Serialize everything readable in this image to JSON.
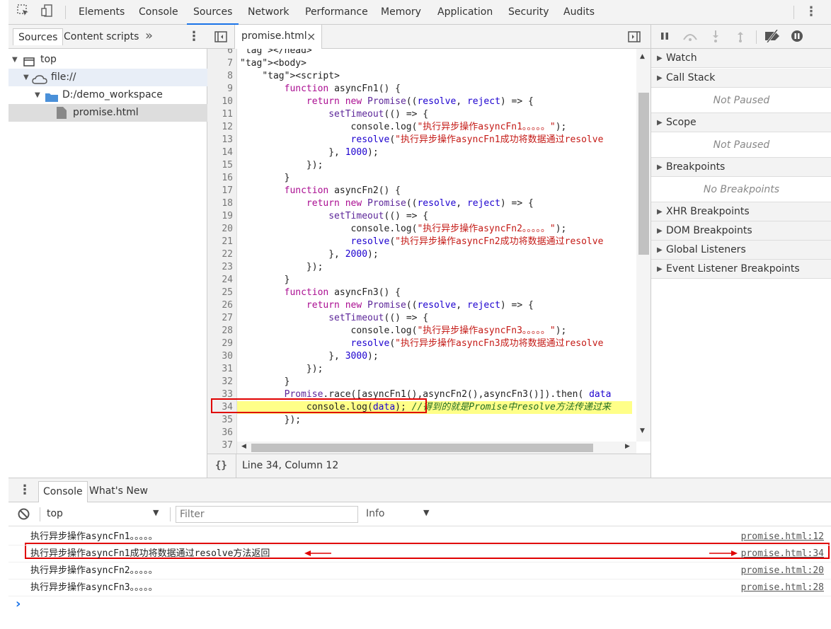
{
  "toolbar": {
    "tabs": [
      "Elements",
      "Console",
      "Sources",
      "Network",
      "Performance",
      "Memory",
      "Application",
      "Security",
      "Audits"
    ],
    "active_tab": "Sources",
    "more_icon": "kebab-icon",
    "accent_color": "#1a73e8"
  },
  "navigator": {
    "tabs": [
      "Sources",
      "Content scripts"
    ],
    "more": "»",
    "tree": [
      {
        "label": "top",
        "icon": "frame-icon"
      },
      {
        "label": "file://",
        "icon": "cloud-icon"
      },
      {
        "label": "D:/demo_workspace",
        "icon": "folder-icon"
      },
      {
        "label": "promise.html",
        "icon": "file-icon"
      }
    ]
  },
  "editor": {
    "tab_label": "promise.html",
    "close": "×",
    "footer_brackets": "{}",
    "cursor_position": "Line 34, Column 12",
    "highlighted_line": 34,
    "lines": [
      {
        "n": "6",
        "t": "</head>"
      },
      {
        "n": "7",
        "t": "<body>"
      },
      {
        "n": "8",
        "t": "    <script>"
      },
      {
        "n": "9",
        "t": "        function asyncFn1() {"
      },
      {
        "n": "10",
        "t": "            return new Promise((resolve, reject) => {"
      },
      {
        "n": "11",
        "t": "                setTimeout(() => {"
      },
      {
        "n": "12",
        "t": "                    console.log(\"执行异步操作asyncFn1。。。。。\");"
      },
      {
        "n": "13",
        "t": "                    resolve(\"执行异步操作asyncFn1成功将数据通过resolve"
      },
      {
        "n": "14",
        "t": "                }, 1000);"
      },
      {
        "n": "15",
        "t": "            });"
      },
      {
        "n": "16",
        "t": "        }"
      },
      {
        "n": "17",
        "t": "        function asyncFn2() {"
      },
      {
        "n": "18",
        "t": "            return new Promise((resolve, reject) => {"
      },
      {
        "n": "19",
        "t": "                setTimeout(() => {"
      },
      {
        "n": "20",
        "t": "                    console.log(\"执行异步操作asyncFn2。。。。。\");"
      },
      {
        "n": "21",
        "t": "                    resolve(\"执行异步操作asyncFn2成功将数据通过resolve"
      },
      {
        "n": "22",
        "t": "                }, 2000);"
      },
      {
        "n": "23",
        "t": "            });"
      },
      {
        "n": "24",
        "t": "        }"
      },
      {
        "n": "25",
        "t": "        function asyncFn3() {"
      },
      {
        "n": "26",
        "t": "            return new Promise((resolve, reject) => {"
      },
      {
        "n": "27",
        "t": "                setTimeout(() => {"
      },
      {
        "n": "28",
        "t": "                    console.log(\"执行异步操作asyncFn3。。。。。\");"
      },
      {
        "n": "29",
        "t": "                    resolve(\"执行异步操作asyncFn3成功将数据通过resolve"
      },
      {
        "n": "30",
        "t": "                }, 3000);"
      },
      {
        "n": "31",
        "t": "            });"
      },
      {
        "n": "32",
        "t": "        }"
      },
      {
        "n": "33",
        "t": "        Promise.race([asyncFn1(),asyncFn2(),asyncFn3()]).then( data"
      },
      {
        "n": "34",
        "t": "            console.log(data); //得到的就是Promise中resolve方法传递过来"
      },
      {
        "n": "35",
        "t": "        });"
      },
      {
        "n": "36",
        "t": ""
      },
      {
        "n": "37",
        "t": ""
      }
    ]
  },
  "sidebar": {
    "sections": [
      {
        "title": "Watch",
        "empty": ""
      },
      {
        "title": "Call Stack",
        "empty": "Not Paused"
      },
      {
        "title": "Scope",
        "empty": "Not Paused"
      },
      {
        "title": "Breakpoints",
        "empty": "No Breakpoints"
      },
      {
        "title": "XHR Breakpoints",
        "empty": ""
      },
      {
        "title": "DOM Breakpoints",
        "empty": ""
      },
      {
        "title": "Global Listeners",
        "empty": ""
      },
      {
        "title": "Event Listener Breakpoints",
        "empty": ""
      }
    ]
  },
  "drawer": {
    "tabs": [
      "Console",
      "What's New"
    ],
    "context": "top",
    "filter_placeholder": "Filter",
    "level": "Info",
    "messages": [
      {
        "text": "执行异步操作asyncFn1。。。。。",
        "source": "promise.html:12"
      },
      {
        "text": "执行异步操作asyncFn1成功将数据通过resolve方法返回",
        "source": "promise.html:34"
      },
      {
        "text": "执行异步操作asyncFn2。。。。。",
        "source": "promise.html:20"
      },
      {
        "text": "执行异步操作asyncFn3。。。。。",
        "source": "promise.html:28"
      }
    ],
    "prompt": "›"
  },
  "annotation_color": "#e00000"
}
